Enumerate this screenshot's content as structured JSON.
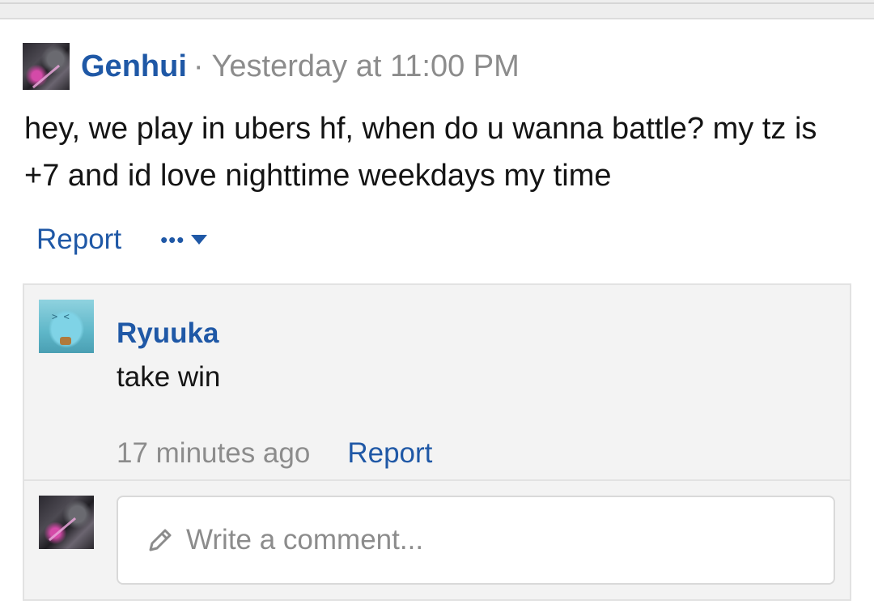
{
  "post": {
    "author": "Genhui",
    "separator": "·",
    "timestamp": "Yesterday at 11:00 PM",
    "body": "hey, we play in ubers hf, when do u wanna battle? my tz is +7 and id love nighttime weekdays my time",
    "report_label": "Report",
    "more_label": "•••"
  },
  "comments": [
    {
      "author": "Ryuuka",
      "text": "take win",
      "time": "17 minutes ago",
      "report_label": "Report"
    }
  ],
  "reply": {
    "placeholder": "Write a comment..."
  },
  "colors": {
    "link": "#1f58a6",
    "muted": "#8c8c8c",
    "text": "#141414",
    "comment_bg": "#f3f3f3"
  }
}
